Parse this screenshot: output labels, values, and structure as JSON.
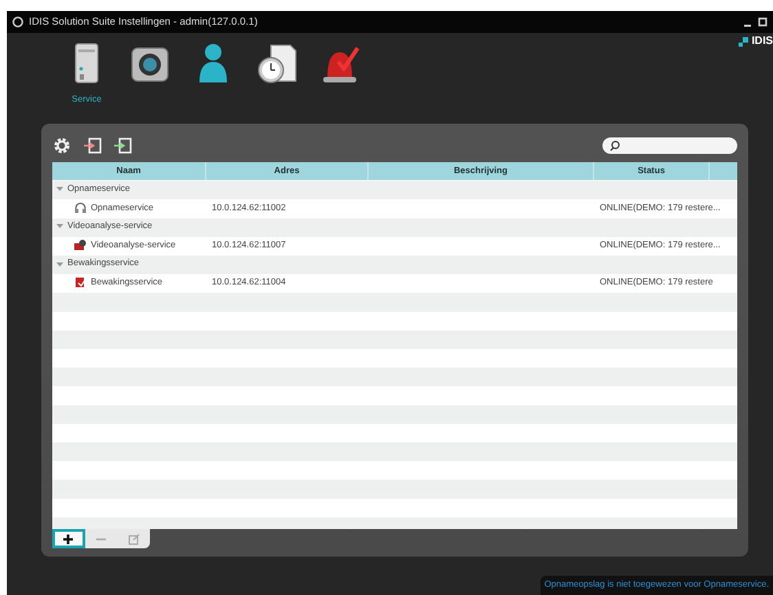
{
  "window": {
    "title": "IDIS Solution Suite Instellingen - admin(127.0.0.1)",
    "logo": "IDIS"
  },
  "modules": [
    {
      "kind": "server",
      "label": "Service"
    },
    {
      "kind": "camera"
    },
    {
      "kind": "user"
    },
    {
      "kind": "schedule"
    },
    {
      "kind": "alarm"
    }
  ],
  "panel_tools": [
    {
      "kind": "settings"
    },
    {
      "kind": "import"
    },
    {
      "kind": "export"
    }
  ],
  "table": {
    "columns": [
      "Naam",
      "Adres",
      "Beschrijving",
      "Status"
    ],
    "groups": [
      {
        "name": "Opnameservice",
        "expanded": true,
        "rows": [
          {
            "kind": "recording",
            "name": "Opnameservice",
            "address": "10.0.124.62:11002",
            "status": "ONLINE(DEMO: 179 restere..."
          }
        ]
      },
      {
        "name": "Videoanalyse-service",
        "expanded": true,
        "rows": [
          {
            "kind": "analysis",
            "name": "Videoanalyse-service",
            "address": "10.0.124.62:11007",
            "status": "ONLINE(DEMO: 179 restere..."
          }
        ]
      },
      {
        "name": "Bewakingsservice",
        "expanded": true,
        "rows": [
          {
            "kind": "monitoring",
            "name": "Bewakingsservice",
            "address": "10.0.124.62:11004",
            "status": "ONLINE(DEMO: 179 restere"
          }
        ]
      }
    ]
  },
  "bottom_buttons": [
    {
      "kind": "add",
      "focused": true,
      "disabled": false
    },
    {
      "kind": "remove",
      "focused": false,
      "disabled": true
    },
    {
      "kind": "edit",
      "focused": false,
      "disabled": true
    }
  ],
  "status_message": "Opnameopslag is niet toegewezen voor Opnameservice."
}
